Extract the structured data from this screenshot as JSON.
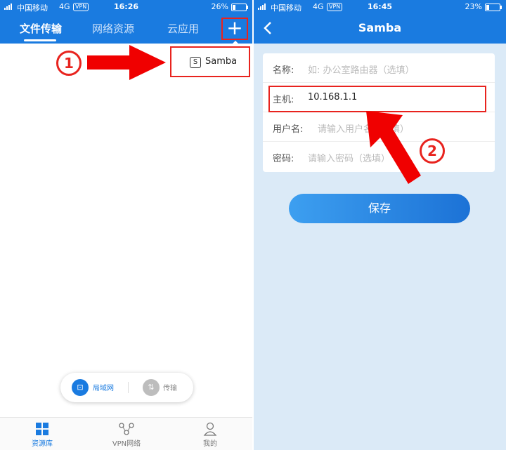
{
  "left": {
    "status": {
      "carrier": "中国移动",
      "network": "4G",
      "vpn": "VPN",
      "time": "16:26",
      "battery": "26%",
      "battery_level": 0.26
    },
    "tabs": [
      {
        "label": "文件传输",
        "active": true
      },
      {
        "label": "网络资源",
        "active": false
      },
      {
        "label": "云应用",
        "active": false
      }
    ],
    "add_button": "+",
    "step_label": "1",
    "popup": {
      "icon_letter": "S",
      "label": "Samba"
    },
    "lan_pill": {
      "lan_label": "局域网",
      "transfer_label": "传输"
    },
    "bottom_tabs": [
      {
        "label": "资源库",
        "icon": "grid-icon",
        "active": true
      },
      {
        "label": "VPN网络",
        "icon": "vpn-network-icon",
        "active": false
      },
      {
        "label": "我的",
        "icon": "user-icon",
        "active": false
      }
    ]
  },
  "right": {
    "status": {
      "carrier": "中国移动",
      "network": "4G",
      "vpn": "VPN",
      "time": "16:45",
      "battery": "23%",
      "battery_level": 0.23
    },
    "title": "Samba",
    "back_icon": "back-chevron-icon",
    "step_label": "2",
    "form": {
      "name": {
        "label": "名称:",
        "placeholder": "如: 办公室路由器（选填）"
      },
      "host": {
        "label": "主机:",
        "value": "10.168.1.1"
      },
      "username": {
        "label": "用户名:",
        "placeholder": "请输入用户名（选填）"
      },
      "password": {
        "label": "密码:",
        "placeholder": "请输入密码（选填）"
      }
    },
    "save_label": "保存"
  },
  "colors": {
    "brand": "#1a7be0",
    "highlight": "#e8231e",
    "arrow": "#f00000"
  }
}
